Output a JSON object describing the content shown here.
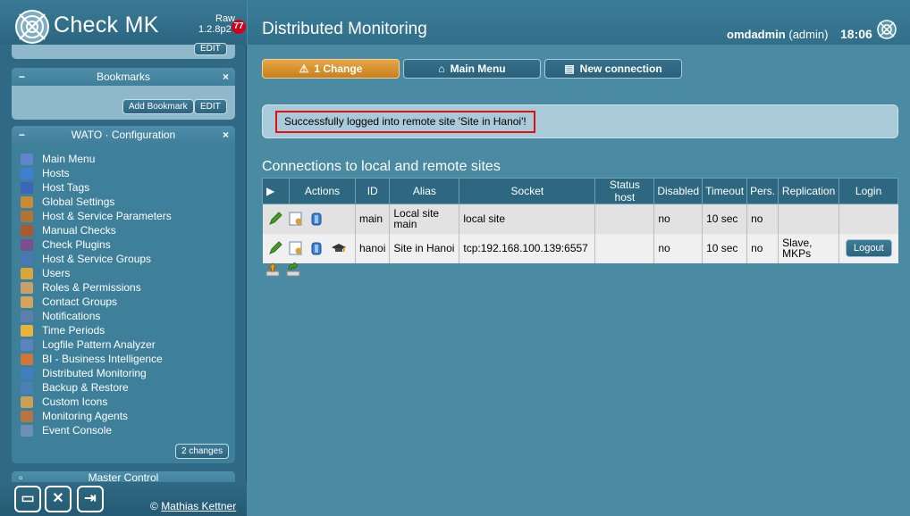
{
  "sidebar": {
    "logo_text": "Check MK",
    "edition": "Raw",
    "version": "1.2.8p2",
    "badge_count": "77",
    "prev_snapin": {
      "edit_label": "EDIT"
    },
    "bookmarks": {
      "title": "Bookmarks",
      "add_label": "Add Bookmark",
      "edit_label": "EDIT"
    },
    "wato": {
      "title": "WATO · Configuration",
      "items": [
        {
          "label": "Main Menu",
          "icon": "home-icon",
          "color": "#5f86c9"
        },
        {
          "label": "Hosts",
          "icon": "hosts-icon",
          "color": "#3f7fd0"
        },
        {
          "label": "Host Tags",
          "icon": "tags-icon",
          "color": "#3a66b8"
        },
        {
          "label": "Global Settings",
          "icon": "settings-icon",
          "color": "#c98a36"
        },
        {
          "label": "Host & Service Parameters",
          "icon": "rulesets-icon",
          "color": "#b07438"
        },
        {
          "label": "Manual Checks",
          "icon": "manual-checks-icon",
          "color": "#a85a2f"
        },
        {
          "label": "Check Plugins",
          "icon": "plugins-icon",
          "color": "#7a4f8c"
        },
        {
          "label": "Host & Service Groups",
          "icon": "groups-icon",
          "color": "#4a78b5"
        },
        {
          "label": "Users",
          "icon": "users-icon",
          "color": "#d9a63a"
        },
        {
          "label": "Roles & Permissions",
          "icon": "roles-icon",
          "color": "#c8a16a"
        },
        {
          "label": "Contact Groups",
          "icon": "contact-groups-icon",
          "color": "#d4a35e"
        },
        {
          "label": "Notifications",
          "icon": "notifications-icon",
          "color": "#5c7fb0"
        },
        {
          "label": "Time Periods",
          "icon": "time-periods-icon",
          "color": "#e8b43a"
        },
        {
          "label": "Logfile Pattern Analyzer",
          "icon": "logfile-icon",
          "color": "#5a84bf"
        },
        {
          "label": "BI - Business Intelligence",
          "icon": "bi-icon",
          "color": "#d0753a"
        },
        {
          "label": "Distributed Monitoring",
          "icon": "distributed-icon",
          "color": "#3f7fc0"
        },
        {
          "label": "Backup & Restore",
          "icon": "backup-icon",
          "color": "#4c7fb8"
        },
        {
          "label": "Custom Icons",
          "icon": "custom-icons-icon",
          "color": "#c9a055"
        },
        {
          "label": "Monitoring Agents",
          "icon": "agents-icon",
          "color": "#b8753f"
        },
        {
          "label": "Event Console",
          "icon": "event-console-icon",
          "color": "#6b8fb5"
        }
      ],
      "changes_label": "2 changes"
    },
    "master_control": {
      "title": "Master Control"
    },
    "copyright_symbol": "©",
    "copyright_name": "Mathias Kettner"
  },
  "header": {
    "title": "Distributed Monitoring",
    "username": "omdadmin",
    "role": "(admin)",
    "time": "18:06"
  },
  "toolbar": {
    "changes_label": "1 Change",
    "main_menu_label": "Main Menu",
    "new_connection_label": "New connection"
  },
  "message": "Successfully logged into remote site 'Site in Hanoi'!",
  "connections": {
    "title": "Connections to local and remote sites",
    "columns": [
      "Actions",
      "ID",
      "Alias",
      "Socket",
      "Status host",
      "Disabled",
      "Timeout",
      "Pers.",
      "Replication",
      "Login"
    ],
    "rows": [
      {
        "id": "main",
        "alias": "Local site main",
        "socket": "local site",
        "status_host": "",
        "disabled": "no",
        "timeout": "10 sec",
        "persistent": "no",
        "replication": "",
        "login": ""
      },
      {
        "id": "hanoi",
        "alias": "Site in Hanoi",
        "socket": "tcp:192.168.100.139:6557",
        "status_host": "",
        "disabled": "no",
        "timeout": "10 sec",
        "persistent": "no",
        "replication": "Slave, MKPs",
        "login": "Logout"
      }
    ]
  },
  "colors": {
    "accent_orange": "#e7a646",
    "sidebar_bg": "#2f6983",
    "page_bg": "#4a8aa3",
    "error_outline": "#e01010"
  }
}
